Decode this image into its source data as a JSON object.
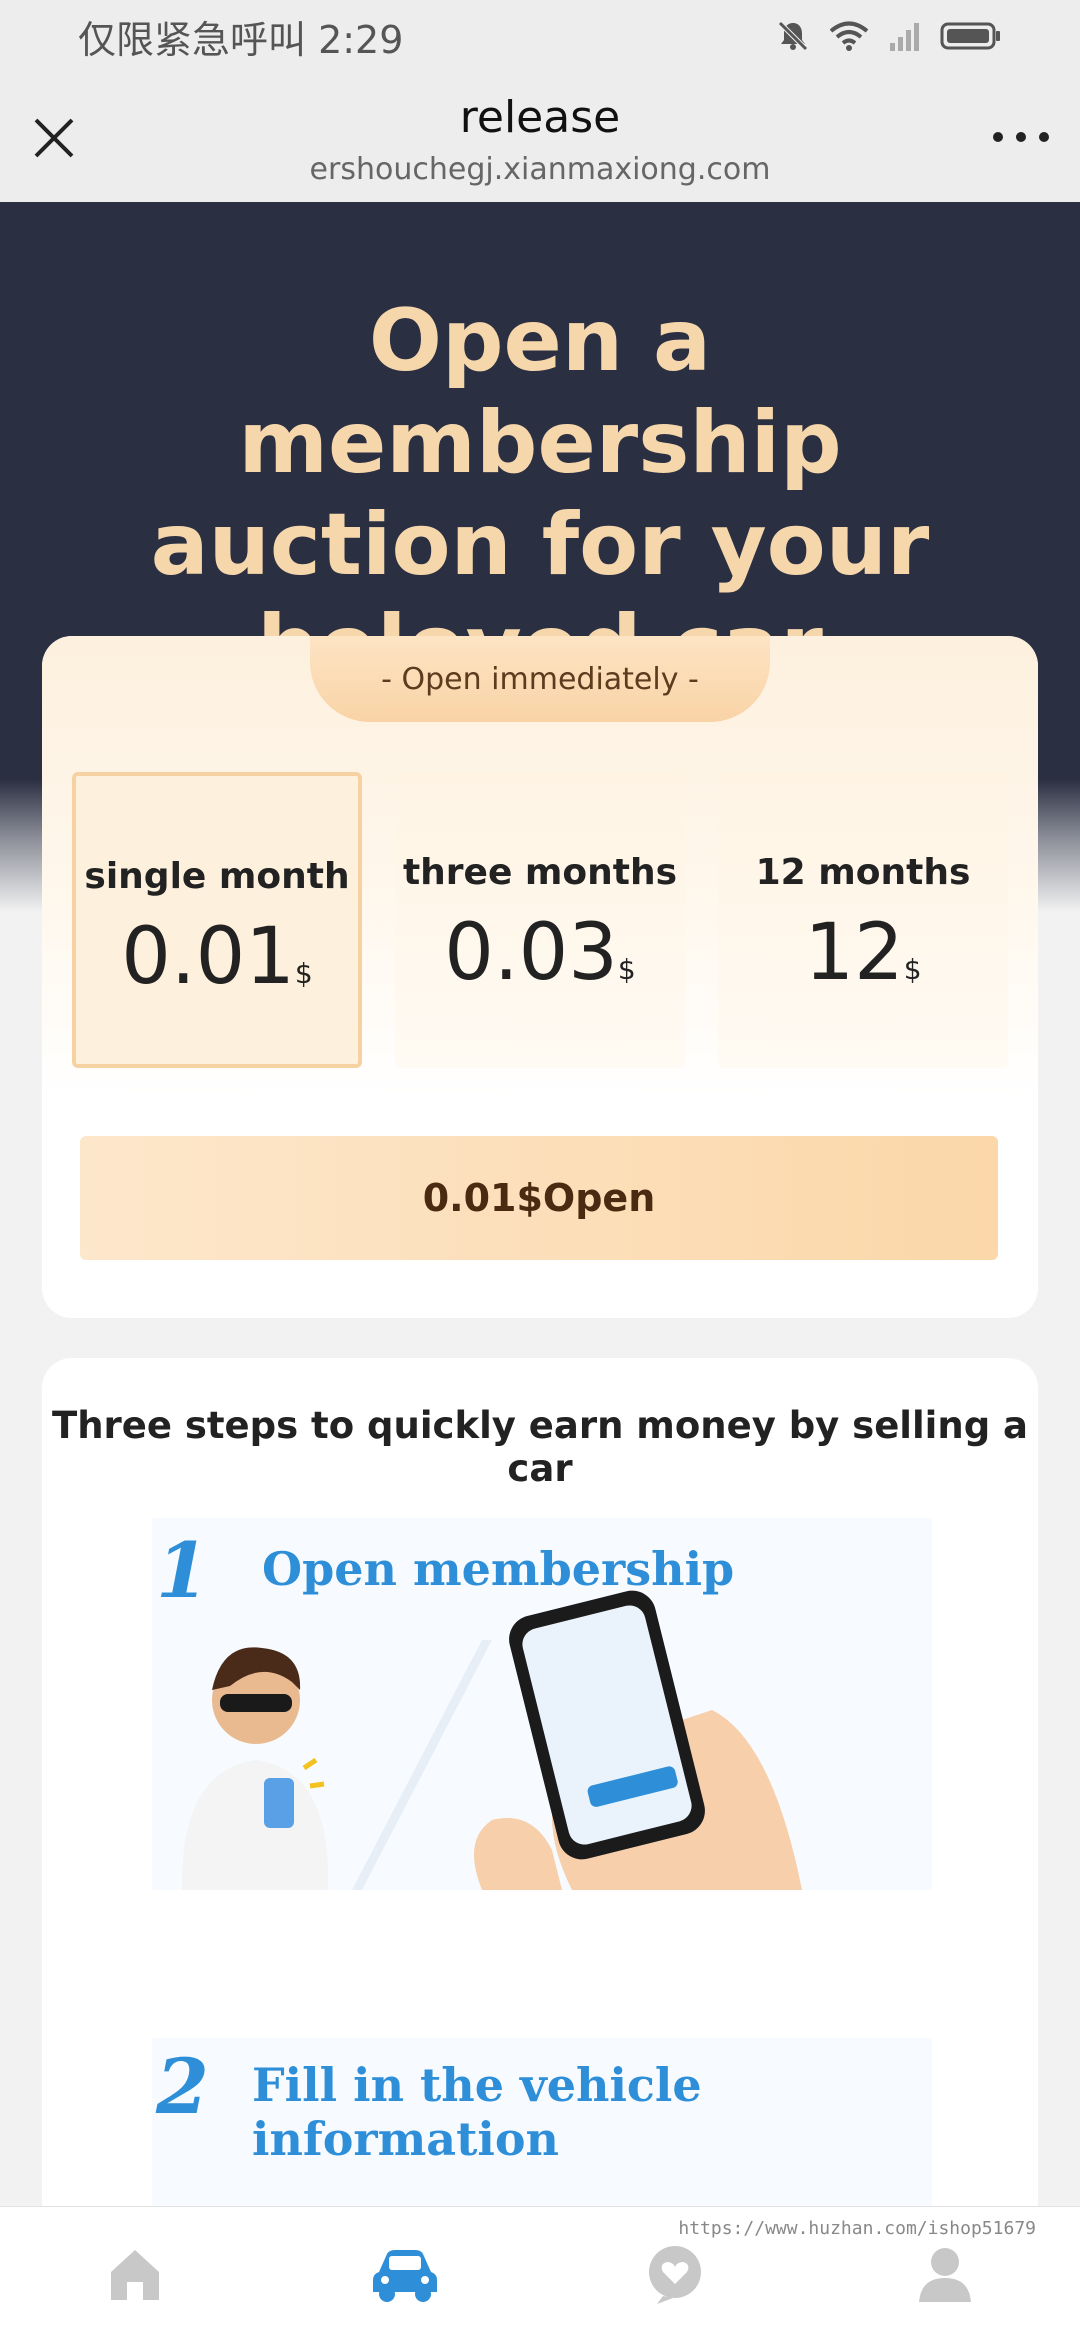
{
  "status_bar": {
    "left_text": "仅限紧急呼叫 2:29",
    "icons": [
      "mute-bell-icon",
      "wifi-icon",
      "signal-icon",
      "battery-icon"
    ]
  },
  "browser": {
    "title": "release",
    "url": "ershouchegj.xianmaxiong.com",
    "close_icon": "close-icon",
    "more_icon": "more-icon"
  },
  "hero": {
    "title": "Open a membership auction for your beloved car"
  },
  "membership": {
    "tab_label": "- Open immediately -",
    "plans": [
      {
        "name": "single month",
        "price": "0.01",
        "currency": "$",
        "selected": true
      },
      {
        "name": "three months",
        "price": "0.03",
        "currency": "$",
        "selected": false
      },
      {
        "name": "12 months",
        "price": "12",
        "currency": "$",
        "selected": false
      }
    ],
    "open_button": "0.01$Open"
  },
  "steps": {
    "title": "Three steps to quickly earn money by selling a car",
    "items": [
      {
        "number": "1",
        "label": "Open membership"
      },
      {
        "number": "2",
        "label": "Fill in the vehicle information"
      }
    ]
  },
  "tab_bar": {
    "tabs": [
      {
        "icon": "home-icon",
        "active": false
      },
      {
        "icon": "car-icon",
        "active": true
      },
      {
        "icon": "chat-icon",
        "active": false
      },
      {
        "icon": "user-icon",
        "active": false
      }
    ]
  },
  "watermark": "https://www.huzhan.com/ishop51679",
  "colors": {
    "hero_bg": "#2b2f42",
    "hero_text": "#f6d6ab",
    "accent_blue": "#2e8fd8",
    "tab_active": "#2e8fd8",
    "tab_inactive": "#c8c8c8"
  }
}
